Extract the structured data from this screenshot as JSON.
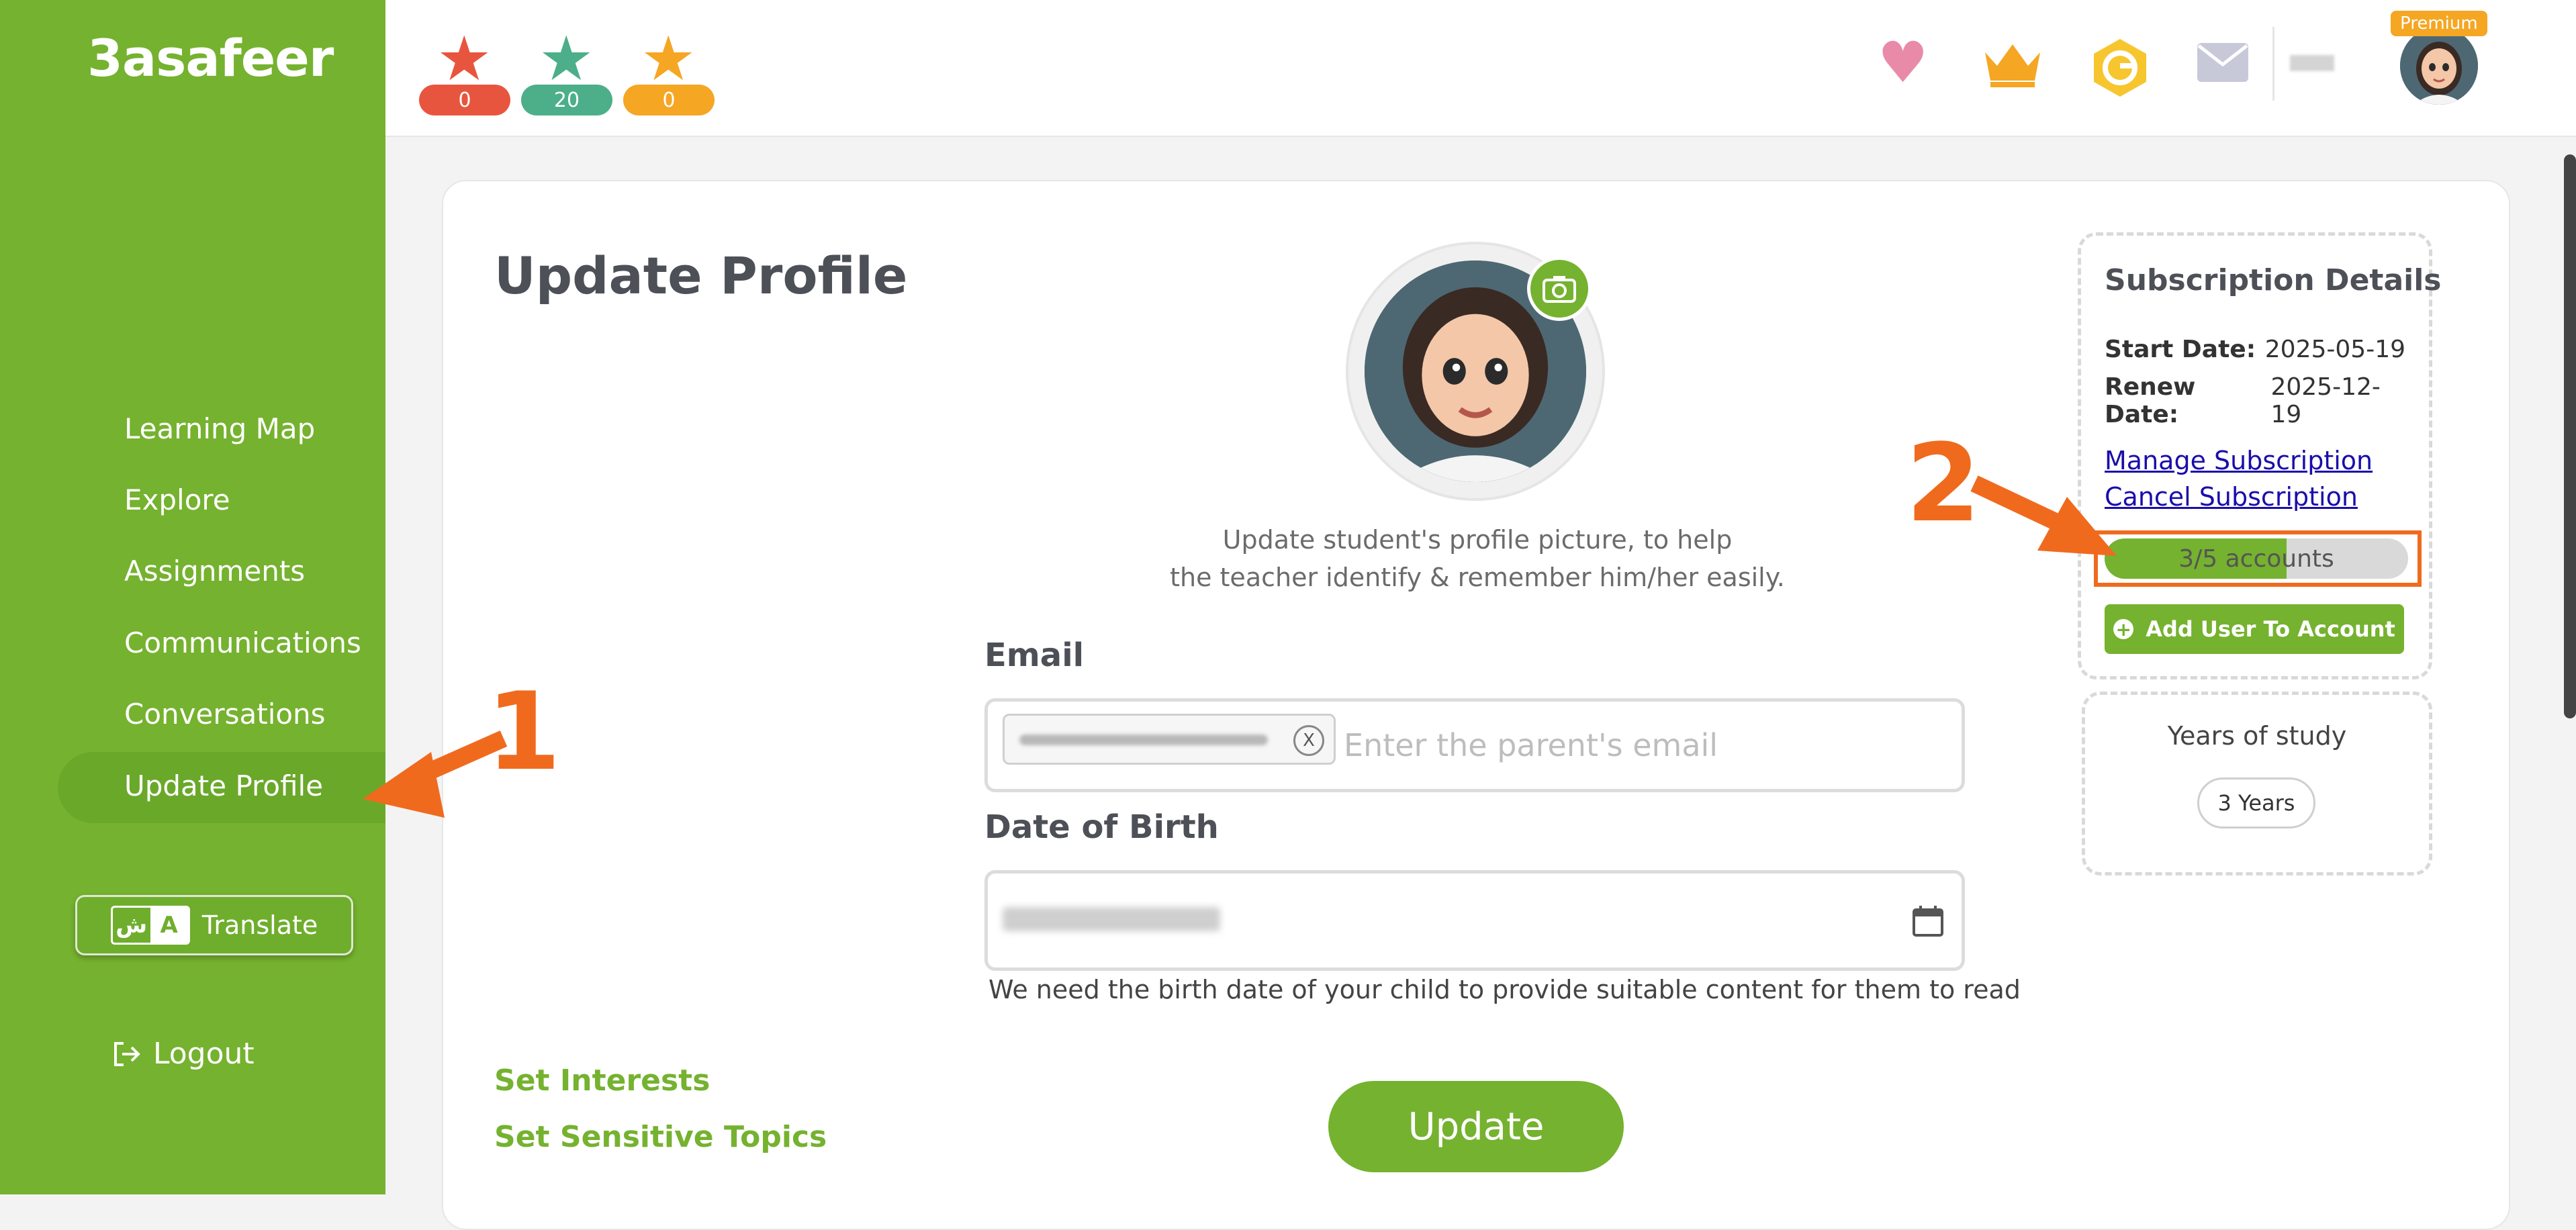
{
  "app": {
    "logo": "3asafeer"
  },
  "sidebar": {
    "items": [
      {
        "label": "Learning Map"
      },
      {
        "label": "Explore"
      },
      {
        "label": "Assignments"
      },
      {
        "label": "Communications"
      },
      {
        "label": "Conversations"
      },
      {
        "label": "Update Profile",
        "active": true
      }
    ],
    "translate": {
      "label": "Translate",
      "icon_ar": "ش",
      "icon_en": "A"
    },
    "logout": {
      "label": "Logout"
    }
  },
  "topbar": {
    "stars": [
      {
        "color": "#e8553e",
        "count": "0"
      },
      {
        "color": "#4caf8a",
        "count": "20"
      },
      {
        "color": "#f5a623",
        "count": "0"
      }
    ],
    "icons": [
      "heart-icon",
      "crown-icon",
      "coin-icon",
      "mail-icon"
    ],
    "premium_badge": "Premium"
  },
  "profile": {
    "title": "Update Profile",
    "help_line1": "Update student's profile picture, to help",
    "help_line2": "the teacher identify & remember him/her easily.",
    "email_label": "Email",
    "email_placeholder": "Enter the parent's email",
    "email_chip_remove": "X",
    "dob_label": "Date of Birth",
    "dob_hint": "We need the birth date of your child to provide suitable content for them to read",
    "set_interests": "Set Interests",
    "set_sensitive": "Set Sensitive Topics",
    "update_button": "Update"
  },
  "subscription": {
    "title": "Subscription Details",
    "start_label": "Start Date:",
    "start_value": "2025-05-19",
    "renew_label": "Renew Date:",
    "renew_value": "2025-12-19",
    "manage": "Manage Subscription",
    "cancel": "Cancel Subscription",
    "accounts_text": "3/5 accounts",
    "accounts_used": 3,
    "accounts_total": 5,
    "add_user": "Add User To Account"
  },
  "years": {
    "title": "Years of study",
    "value": "3 Years"
  },
  "annotations": {
    "one": "1",
    "two": "2"
  },
  "colors": {
    "brand_green": "#75b22f",
    "annotation_orange": "#f06a1e"
  }
}
